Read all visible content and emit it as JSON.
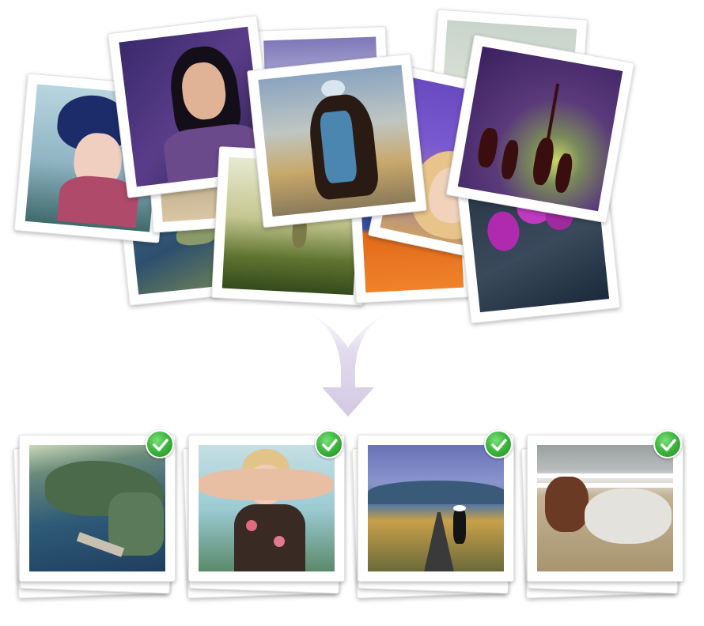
{
  "colors": {
    "arrow": "#dcd6e8",
    "check_green": "#3fb83f",
    "frame": "#ffffff"
  },
  "icons": {
    "merge_arrow": "down-merge-arrow-icon",
    "selected": "checkmark-icon"
  },
  "scattered_photos": [
    {
      "name": "photo-blue-hat-girl"
    },
    {
      "name": "photo-dark-hair-woman"
    },
    {
      "name": "photo-coastline"
    },
    {
      "name": "photo-grass-field"
    },
    {
      "name": "photo-girl-on-path"
    },
    {
      "name": "photo-orange-roof-cat"
    },
    {
      "name": "photo-blonde-purple"
    },
    {
      "name": "photo-windmill-silhouettes"
    },
    {
      "name": "photo-purple-flowers"
    }
  ],
  "selected_stacks": [
    {
      "name": "stack-coastline",
      "checked": true
    },
    {
      "name": "stack-blonde-woman",
      "checked": true
    },
    {
      "name": "stack-mountain-path",
      "checked": true
    },
    {
      "name": "stack-horses",
      "checked": true
    }
  ]
}
